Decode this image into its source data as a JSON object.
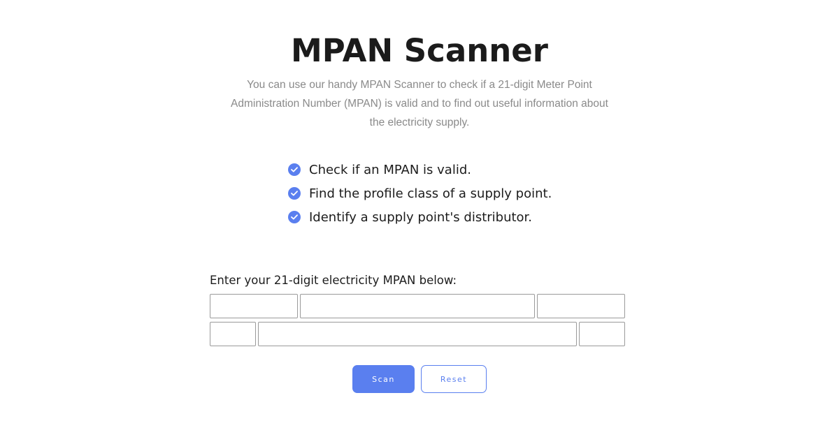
{
  "page": {
    "title": "MPAN Scanner",
    "intro": "You can use our handy MPAN Scanner to check if a 21-digit Meter Point Administration Number (MPAN) is valid and to find out useful information about the electricity supply."
  },
  "features": [
    {
      "text": "Check if an MPAN is valid.",
      "icon": "check-circle-icon"
    },
    {
      "text": "Find the profile class of a supply point.",
      "icon": "check-circle-icon"
    },
    {
      "text": "Identify a supply point's distributor.",
      "icon": "check-circle-icon"
    }
  ],
  "form": {
    "label": "Enter your 21-digit electricity MPAN below:",
    "fields": {
      "profile_class": "",
      "meter_time_switch_code": "",
      "line_loss_factor": "",
      "distributor_id": "",
      "unique_id": "",
      "check_digit": ""
    }
  },
  "buttons": {
    "scan_label": "Scan",
    "reset_label": "Reset"
  },
  "colors": {
    "accent": "#5a7fef",
    "title": "#1b1b1b",
    "muted_text": "#8a8a8a",
    "input_border": "#9a9a9a"
  }
}
